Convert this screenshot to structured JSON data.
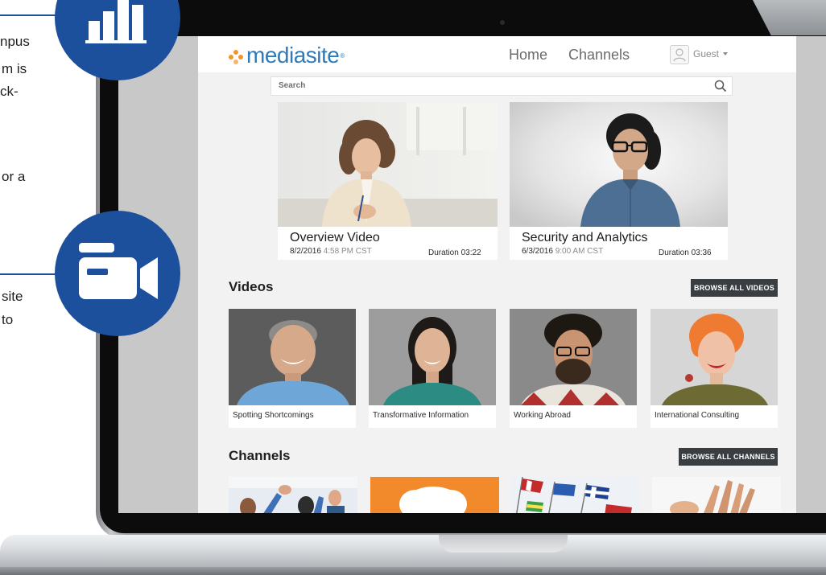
{
  "side_text": {
    "line1": "npus",
    "line2": "m is",
    "line3": "ck-",
    "line4": "",
    "line5": "or a",
    "line6": "site",
    "line7": "to"
  },
  "colors": {
    "badge_blue": "#1c4f9c",
    "logo_blue": "#2f7ab8",
    "logo_orange": "#f0962a",
    "button_dark": "#3a3d42"
  },
  "icons": {
    "badge_top": "bar-chart-icon",
    "badge_bottom": "video-camera-icon"
  },
  "header": {
    "logo_text": "mediasite",
    "nav": {
      "home": "Home",
      "channels": "Channels"
    },
    "user": {
      "name": "Guest"
    }
  },
  "search": {
    "placeholder": "Search"
  },
  "featured": [
    {
      "title": "Overview Video",
      "date": "8/2/2016",
      "time": "4:58 PM CST",
      "duration": "Duration 03:22"
    },
    {
      "title": "Security and Analytics",
      "date": "6/3/2016",
      "time": "9:00 AM CST",
      "duration": "Duration 03:36"
    }
  ],
  "videos": {
    "heading": "Videos",
    "browse_label": "BROWSE ALL VIDEOS",
    "items": [
      {
        "title": "Spotting Shortcomings"
      },
      {
        "title": "Transformative Information"
      },
      {
        "title": "Working Abroad"
      },
      {
        "title": "International Consulting"
      }
    ]
  },
  "channels": {
    "heading": "Channels",
    "browse_label": "BROWSE ALL CHANNELS"
  }
}
